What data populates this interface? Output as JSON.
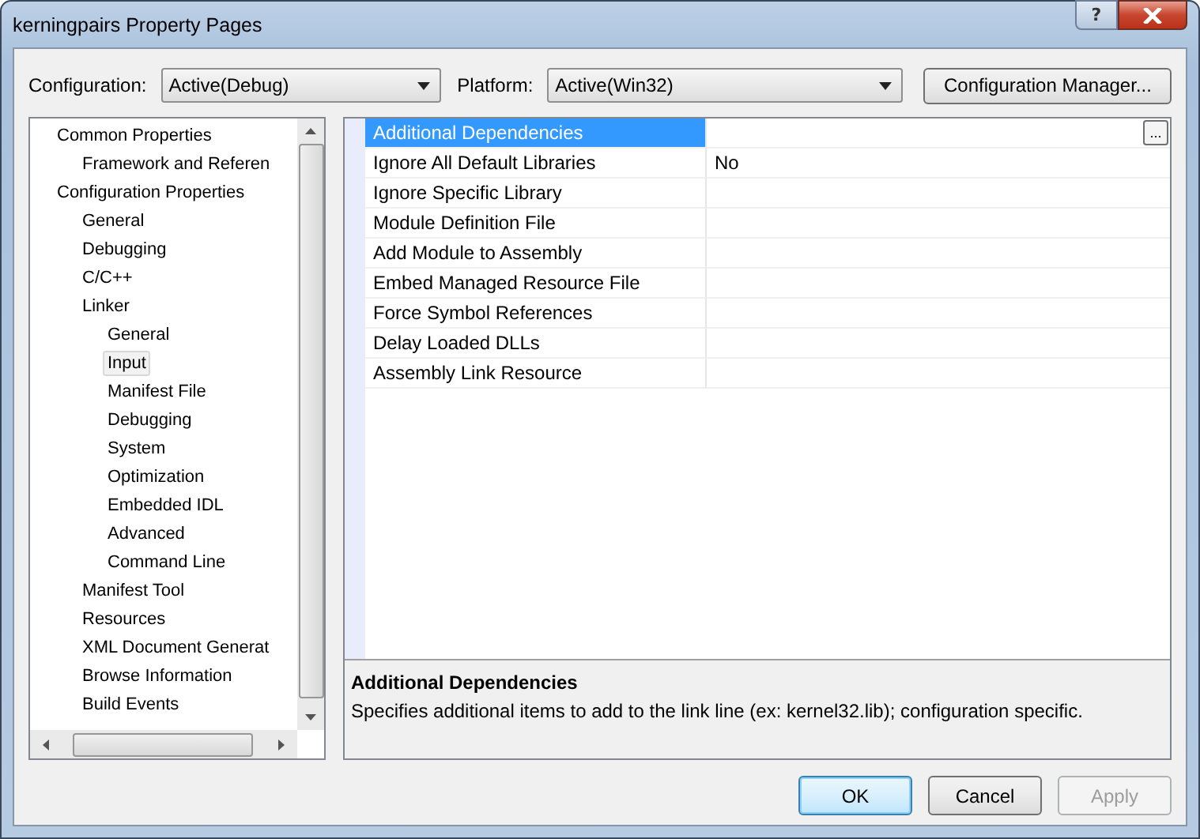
{
  "window": {
    "title": "kerningpairs Property Pages",
    "help_button": "?"
  },
  "configuration": {
    "label": "Configuration:",
    "value": "Active(Debug)"
  },
  "platform": {
    "label": "Platform:",
    "value": "Active(Win32)"
  },
  "configuration_manager_button": "Configuration Manager...",
  "tree": [
    {
      "label": "Common Properties",
      "selected": false,
      "children": [
        {
          "label": "Framework and Referen",
          "selected": false
        }
      ]
    },
    {
      "label": "Configuration Properties",
      "selected": false,
      "children": [
        {
          "label": "General",
          "selected": false
        },
        {
          "label": "Debugging",
          "selected": false
        },
        {
          "label": "C/C++",
          "selected": false
        },
        {
          "label": "Linker",
          "selected": false,
          "children": [
            {
              "label": "General",
              "selected": false
            },
            {
              "label": "Input",
              "selected": true
            },
            {
              "label": "Manifest File",
              "selected": false
            },
            {
              "label": "Debugging",
              "selected": false
            },
            {
              "label": "System",
              "selected": false
            },
            {
              "label": "Optimization",
              "selected": false
            },
            {
              "label": "Embedded IDL",
              "selected": false
            },
            {
              "label": "Advanced",
              "selected": false
            },
            {
              "label": "Command Line",
              "selected": false
            }
          ]
        },
        {
          "label": "Manifest Tool",
          "selected": false
        },
        {
          "label": "Resources",
          "selected": false
        },
        {
          "label": "XML Document Generat",
          "selected": false
        },
        {
          "label": "Browse Information",
          "selected": false
        },
        {
          "label": "Build Events",
          "selected": false
        }
      ]
    }
  ],
  "properties": [
    {
      "name": "Additional Dependencies",
      "selected": true,
      "browse_button": "..."
    },
    {
      "name": "Ignore All Default Libraries",
      "value": "No",
      "selected": false
    },
    {
      "name": "Ignore Specific Library",
      "selected": false
    },
    {
      "name": "Module Definition File",
      "selected": false
    },
    {
      "name": "Add Module to Assembly",
      "selected": false
    },
    {
      "name": "Embed Managed Resource File",
      "selected": false
    },
    {
      "name": "Force Symbol References",
      "selected": false
    },
    {
      "name": "Delay Loaded DLLs",
      "selected": false
    },
    {
      "name": "Assembly Link Resource",
      "selected": false
    }
  ],
  "description": {
    "title": "Additional Dependencies",
    "text": "Specifies additional items to add to the link line (ex: kernel32.lib); configuration specific."
  },
  "buttons": [
    {
      "label": "OK",
      "default": true,
      "disabled": false
    },
    {
      "label": "Cancel",
      "default": false,
      "disabled": false
    },
    {
      "label": "Apply",
      "default": false,
      "disabled": true
    }
  ]
}
